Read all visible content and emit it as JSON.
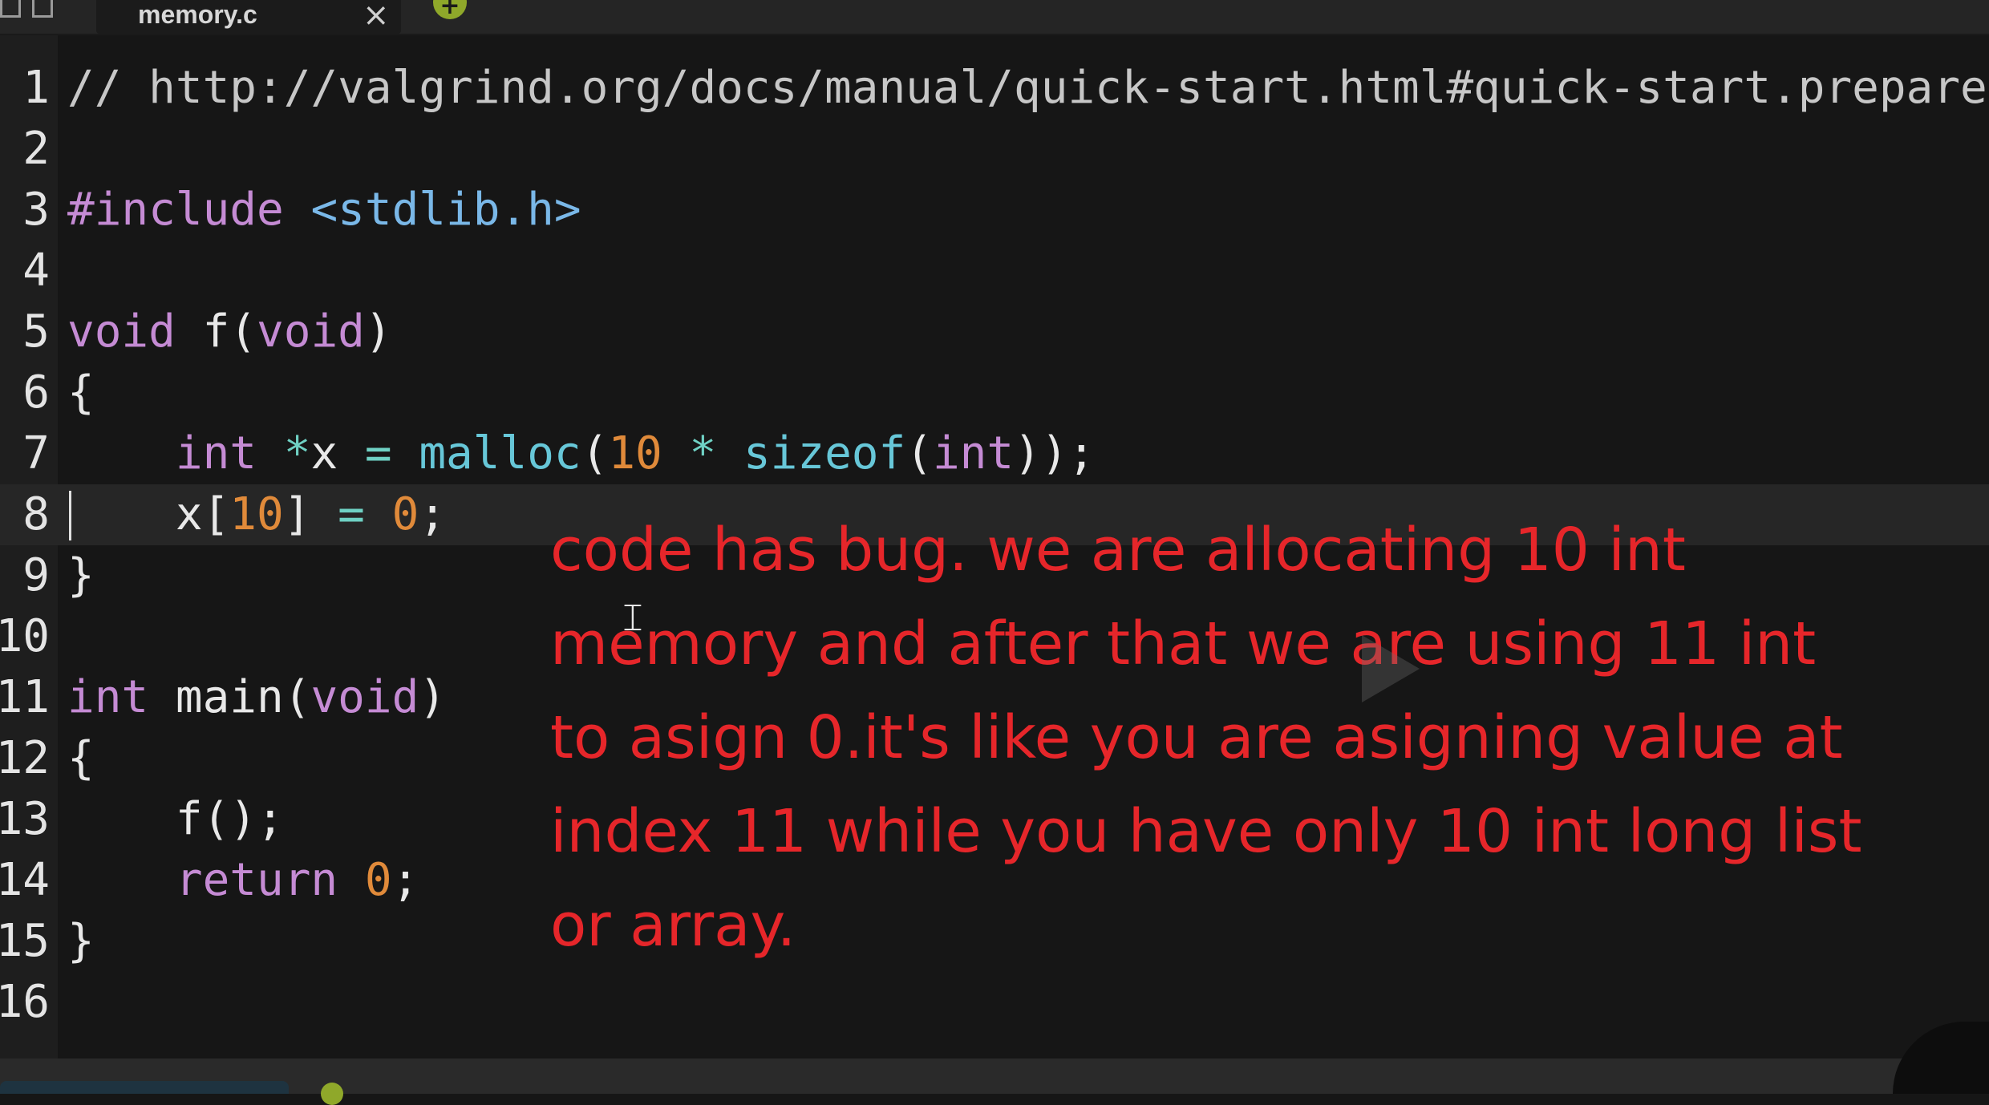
{
  "tab": {
    "title": "memory.c",
    "close_label": "×",
    "add_label": "+"
  },
  "editor": {
    "lines": [
      {
        "num": "1",
        "tokens": [
          {
            "t": "// http://valgrind.org/docs/manual/quick-start.html#quick-start.prepare",
            "c": "cm"
          }
        ]
      },
      {
        "num": "2",
        "tokens": []
      },
      {
        "num": "3",
        "tokens": [
          {
            "t": "#include ",
            "c": "pp"
          },
          {
            "t": "<stdlib.h>",
            "c": "inc"
          }
        ]
      },
      {
        "num": "4",
        "tokens": []
      },
      {
        "num": "5",
        "tokens": [
          {
            "t": "void",
            "c": "kw"
          },
          {
            "t": " f(",
            "c": "pl"
          },
          {
            "t": "void",
            "c": "kw"
          },
          {
            "t": ")",
            "c": "pl"
          }
        ]
      },
      {
        "num": "6",
        "tokens": [
          {
            "t": "{",
            "c": "pl"
          }
        ]
      },
      {
        "num": "7",
        "tokens": [
          {
            "t": "    ",
            "c": "pl"
          },
          {
            "t": "int",
            "c": "ty"
          },
          {
            "t": " ",
            "c": "pl"
          },
          {
            "t": "*",
            "c": "op"
          },
          {
            "t": "x ",
            "c": "pl"
          },
          {
            "t": "=",
            "c": "op"
          },
          {
            "t": " ",
            "c": "pl"
          },
          {
            "t": "malloc",
            "c": "lib"
          },
          {
            "t": "(",
            "c": "pl"
          },
          {
            "t": "10",
            "c": "num"
          },
          {
            "t": " ",
            "c": "pl"
          },
          {
            "t": "*",
            "c": "op"
          },
          {
            "t": " ",
            "c": "pl"
          },
          {
            "t": "sizeof",
            "c": "lib"
          },
          {
            "t": "(",
            "c": "pl"
          },
          {
            "t": "int",
            "c": "ty"
          },
          {
            "t": "));",
            "c": "pl"
          }
        ]
      },
      {
        "num": "8",
        "current": true,
        "tokens": [
          {
            "t": "    x[",
            "c": "pl"
          },
          {
            "t": "10",
            "c": "num"
          },
          {
            "t": "] ",
            "c": "pl"
          },
          {
            "t": "=",
            "c": "op"
          },
          {
            "t": " ",
            "c": "pl"
          },
          {
            "t": "0",
            "c": "num"
          },
          {
            "t": ";",
            "c": "pl"
          }
        ]
      },
      {
        "num": "9",
        "tokens": [
          {
            "t": "}",
            "c": "pl"
          }
        ]
      },
      {
        "num": "10",
        "tokens": []
      },
      {
        "num": "11",
        "tokens": [
          {
            "t": "int",
            "c": "ty"
          },
          {
            "t": " main(",
            "c": "pl"
          },
          {
            "t": "void",
            "c": "kw"
          },
          {
            "t": ")",
            "c": "pl"
          }
        ]
      },
      {
        "num": "12",
        "tokens": [
          {
            "t": "{",
            "c": "pl"
          }
        ]
      },
      {
        "num": "13",
        "tokens": [
          {
            "t": "    f();",
            "c": "pl"
          }
        ]
      },
      {
        "num": "14",
        "tokens": [
          {
            "t": "    ",
            "c": "pl"
          },
          {
            "t": "return",
            "c": "kw"
          },
          {
            "t": " ",
            "c": "pl"
          },
          {
            "t": "0",
            "c": "num"
          },
          {
            "t": ";",
            "c": "pl"
          }
        ]
      },
      {
        "num": "15",
        "tokens": [
          {
            "t": "}",
            "c": "pl"
          }
        ]
      },
      {
        "num": "16",
        "tokens": []
      }
    ]
  },
  "annotation": {
    "text": "code has bug. we are allocating 10 int\nmemory and after that we are using 11 int\nto asign 0.it's like you are asigning value at\nindex 11 while you have only 10 int long list\nor array.",
    "color": "#e6262a"
  },
  "icons": {
    "play": "play-icon",
    "cursor": "text-cursor-icon"
  },
  "colors": {
    "background": "#161616",
    "comment": "#c7c7c7",
    "keyword": "#c58bd4",
    "include": "#7ab8e8",
    "operator": "#6fd1c4",
    "number": "#e08a3a",
    "library": "#67c7d8"
  }
}
